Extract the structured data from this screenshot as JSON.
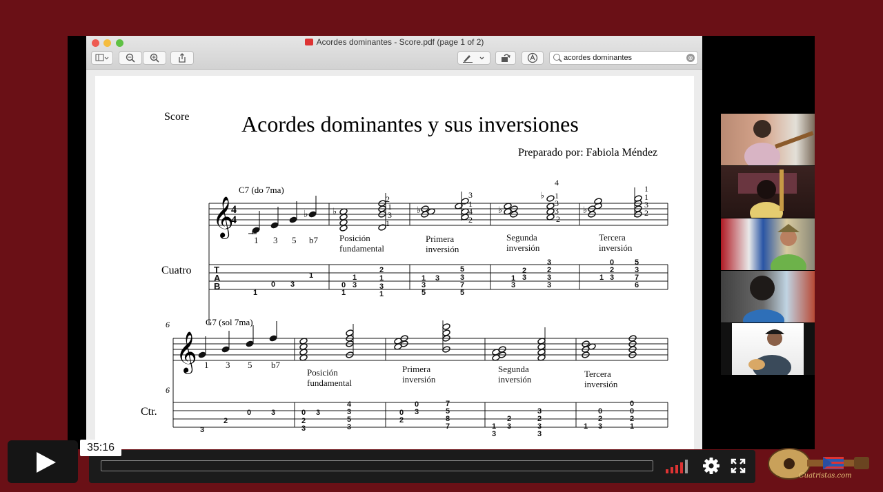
{
  "window": {
    "title": "Acordes dominantes - Score.pdf (page 1 of 2)",
    "search_value": "acordes dominantes",
    "clear_symbol": "⊗"
  },
  "toolbar": {
    "sidebar_icon": "sidebar-icon",
    "zoom_out_icon": "zoom-out-icon",
    "zoom_in_icon": "zoom-in-icon",
    "share_icon": "share-icon",
    "markup_icon": "pen-icon",
    "rotate_icon": "rotate-icon",
    "annotate_icon": "annotate-icon"
  },
  "score": {
    "label": "Score",
    "title": "Acordes dominantes y sus inversiones",
    "author": "Preparado por: Fabiola Méndez",
    "system1": {
      "chord": "C7  (do 7ma)",
      "instrument": "Cuatro",
      "degrees": [
        "1",
        "3",
        "5",
        "b7"
      ],
      "sections": [
        "Posición",
        "fundamental",
        "Primera",
        "inversión",
        "Segunda",
        "inversión",
        "Tercera",
        "inversión"
      ],
      "tab_letters": [
        "T",
        "A",
        "B"
      ]
    },
    "system2": {
      "measure": "6",
      "chord": "G7 (sol 7ma)",
      "instrument": "Ctr.",
      "degrees": [
        "1",
        "3",
        "5",
        "b7"
      ],
      "sections": [
        "Posición",
        "fundamental",
        "Primera",
        "inversión",
        "Segunda",
        "inversión",
        "Tercera",
        "inversión"
      ]
    }
  },
  "player": {
    "time": "35:16",
    "settings_icon": "gear-icon",
    "fullscreen_icon": "fullscreen-icon",
    "volume_icon": "volume-bars-icon",
    "logo_text": "Cuatristas.com"
  },
  "colors": {
    "background": "#6a1016",
    "accent": "#d33333"
  }
}
